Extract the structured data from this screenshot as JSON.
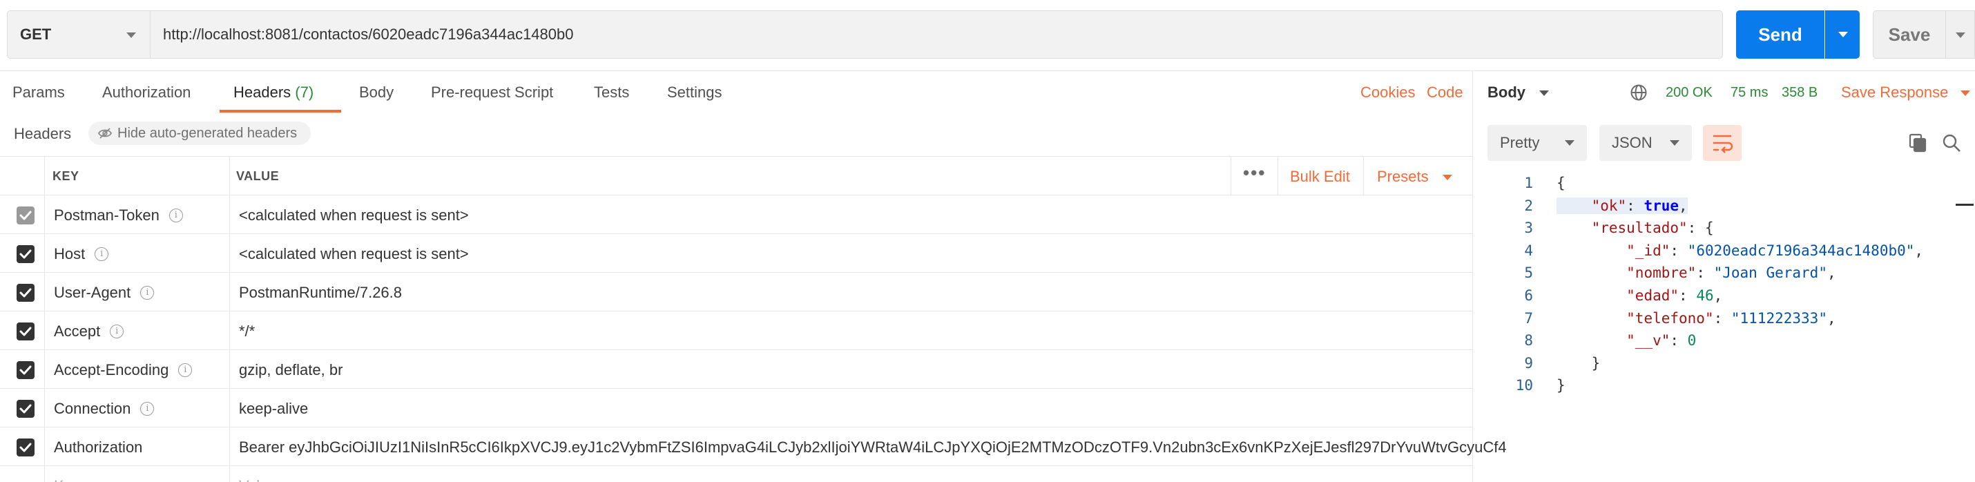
{
  "request": {
    "method": "GET",
    "url": "http://localhost:8081/contactos/6020eadc7196a344ac1480b0",
    "send_label": "Send",
    "save_label": "Save"
  },
  "request_tabs": [
    {
      "label": "Params"
    },
    {
      "label": "Authorization"
    },
    {
      "label": "Headers",
      "count": "(7)",
      "active": true
    },
    {
      "label": "Body"
    },
    {
      "label": "Pre-request Script"
    },
    {
      "label": "Tests"
    },
    {
      "label": "Settings"
    }
  ],
  "links": {
    "cookies": "Cookies",
    "code": "Code"
  },
  "headers_section": {
    "label": "Headers",
    "hide_auto": "Hide auto-generated headers",
    "col_key": "KEY",
    "col_value": "VALUE",
    "more": "•••",
    "bulk_edit": "Bulk Edit",
    "presets": "Presets"
  },
  "header_rows": [
    {
      "key": "Postman-Token",
      "value": "<calculated when request is sent>",
      "checked": true,
      "disabled": true,
      "info": true
    },
    {
      "key": "Host",
      "value": "<calculated when request is sent>",
      "checked": true,
      "info": true
    },
    {
      "key": "User-Agent",
      "value": "PostmanRuntime/7.26.8",
      "checked": true,
      "info": true
    },
    {
      "key": "Accept",
      "value": "*/*",
      "checked": true,
      "info": true
    },
    {
      "key": "Accept-Encoding",
      "value": "gzip, deflate, br",
      "checked": true,
      "info": true
    },
    {
      "key": "Connection",
      "value": "keep-alive",
      "checked": true,
      "info": true
    },
    {
      "key": "Authorization",
      "value": "Bearer eyJhbGciOiJIUzI1NiIsInR5cCI6IkpXVCJ9.eyJ1c2VybmFtZSI6ImpvaG4iLCJyb2xlIjoiYWRtaW4iLCJpYXQiOjE2MTMzODczOTF9.Vn2ubn3cEx6vnKPzXejEJesfl297DrYvuWtvGcyuCf4",
      "checked": true,
      "info": false
    }
  ],
  "placeholder_row": {
    "key": "Key",
    "value": "Value"
  },
  "response": {
    "body_label": "Body",
    "status": "200 OK",
    "time": "75 ms",
    "size": "358 B",
    "save_response": "Save Response",
    "format": "Pretty",
    "language": "JSON"
  },
  "response_json": [
    {
      "n": "1",
      "segs": [
        [
          "p",
          "{"
        ]
      ]
    },
    {
      "n": "2",
      "hl": true,
      "segs": [
        [
          "p",
          "    "
        ],
        [
          "k",
          "\"ok\""
        ],
        [
          "p",
          ": "
        ],
        [
          "b",
          "true"
        ],
        [
          "p",
          ","
        ]
      ]
    },
    {
      "n": "3",
      "segs": [
        [
          "p",
          "    "
        ],
        [
          "k",
          "\"resultado\""
        ],
        [
          "p",
          ": {"
        ]
      ]
    },
    {
      "n": "4",
      "segs": [
        [
          "p",
          "        "
        ],
        [
          "k",
          "\"_id\""
        ],
        [
          "p",
          ": "
        ],
        [
          "s",
          "\"6020eadc7196a344ac1480b0\""
        ],
        [
          "p",
          ","
        ]
      ]
    },
    {
      "n": "5",
      "segs": [
        [
          "p",
          "        "
        ],
        [
          "k",
          "\"nombre\""
        ],
        [
          "p",
          ": "
        ],
        [
          "s",
          "\"Joan Gerard\""
        ],
        [
          "p",
          ","
        ]
      ]
    },
    {
      "n": "6",
      "segs": [
        [
          "p",
          "        "
        ],
        [
          "k",
          "\"edad\""
        ],
        [
          "p",
          ": "
        ],
        [
          "n",
          "46"
        ],
        [
          "p",
          ","
        ]
      ]
    },
    {
      "n": "7",
      "segs": [
        [
          "p",
          "        "
        ],
        [
          "k",
          "\"telefono\""
        ],
        [
          "p",
          ": "
        ],
        [
          "s",
          "\"111222333\""
        ],
        [
          "p",
          ","
        ]
      ]
    },
    {
      "n": "8",
      "segs": [
        [
          "p",
          "        "
        ],
        [
          "k",
          "\"__v\""
        ],
        [
          "p",
          ": "
        ],
        [
          "n",
          "0"
        ]
      ]
    },
    {
      "n": "9",
      "segs": [
        [
          "p",
          "    }"
        ]
      ]
    },
    {
      "n": "10",
      "segs": [
        [
          "p",
          "}"
        ]
      ]
    }
  ],
  "colors": {
    "accent": "#f26b3a",
    "primary": "#097bed",
    "success": "#2a8a35"
  }
}
